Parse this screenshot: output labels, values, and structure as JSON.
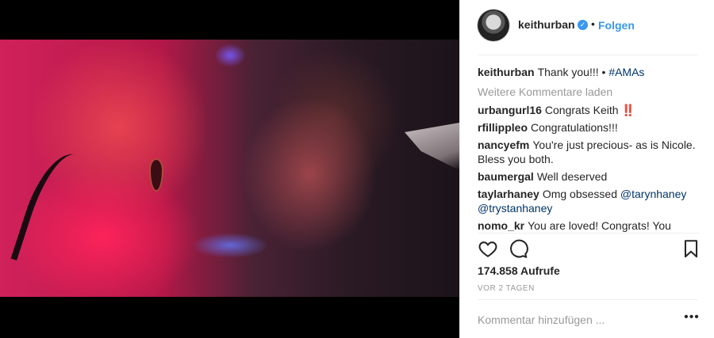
{
  "post": {
    "username": "keithurban",
    "follow_label": "Folgen",
    "separator": "•",
    "verified_icon": "verified-badge-icon",
    "colors": {
      "accent": "#3897f0",
      "link": "#003569",
      "muted": "#999999",
      "alert": "#e0245e"
    }
  },
  "caption": {
    "user": "keithurban",
    "text": "Thank you!!! • ",
    "hashtag": "#AMAs"
  },
  "load_more_label": "Weitere Kommentare laden",
  "comments": [
    {
      "user": "urbangurl16",
      "text": "Congrats Keith ",
      "emoji": "‼️"
    },
    {
      "user": "rfillippleo",
      "text": "Congratulations!!!"
    },
    {
      "user": "nancyefm",
      "text": "You're just precious- as is Nicole. Bless you both."
    },
    {
      "user": "baumergal",
      "text": "Well deserved"
    },
    {
      "user": "taylarhaney",
      "text": "Omg obsessed ",
      "mention1": "@tarynhaney",
      "mention2": "@trystanhaney"
    },
    {
      "user": "nomo_kr",
      "text": "You are loved! Congrats! You"
    }
  ],
  "actions": {
    "like_icon": "heart-icon",
    "comment_icon": "comment-bubble-icon",
    "save_icon": "bookmark-icon"
  },
  "views": "174.858 Aufrufe",
  "timestamp": "VOR 2 TAGEN",
  "comment_box": {
    "placeholder": "Kommentar hinzufügen ...",
    "more_label": "•••",
    "more_icon": "more-options-icon"
  }
}
